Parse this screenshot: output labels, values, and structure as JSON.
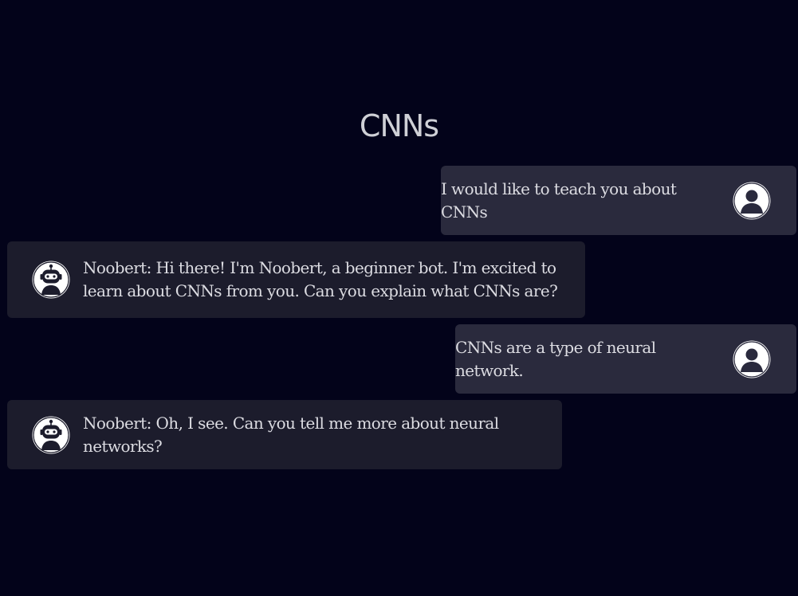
{
  "page": {
    "title": "CNNs"
  },
  "messages": [
    {
      "role": "user",
      "text": "I would like to teach you about CNNs",
      "avatar": "user-avatar-icon"
    },
    {
      "role": "bot",
      "text": "Noobert: Hi there! I'm Noobert, a beginner bot. I'm excited to learn about CNNs from you. Can you explain what CNNs are?",
      "avatar": "robot-avatar-icon"
    },
    {
      "role": "user",
      "text": "CNNs are a type of neural network.",
      "avatar": "user-avatar-icon"
    },
    {
      "role": "bot",
      "text": "Noobert: Oh, I see. Can you tell me more about neural networks?",
      "avatar": "robot-avatar-icon"
    }
  ],
  "colors": {
    "background": "#03031a",
    "user_bubble": "#2a2a3d",
    "bot_bubble": "#1c1c2c",
    "text": "#dcdce2"
  }
}
